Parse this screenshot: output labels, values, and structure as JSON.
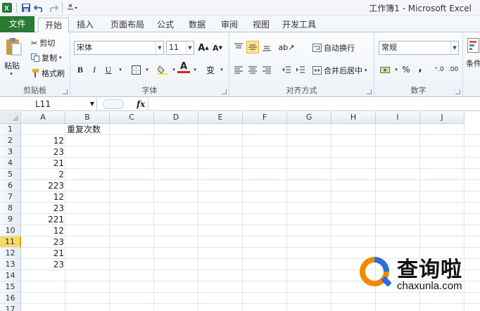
{
  "title": "工作簿1 - Microsoft Excel",
  "tabs": {
    "file": "文件",
    "items": [
      "开始",
      "插入",
      "页面布局",
      "公式",
      "数据",
      "审阅",
      "视图",
      "开发工具"
    ]
  },
  "ribbon": {
    "clipboard": {
      "paste": "粘贴",
      "cut": "剪切",
      "copy": "复制",
      "format_painter": "格式刷",
      "label": "剪贴板"
    },
    "font": {
      "name": "宋体",
      "size": "11",
      "label": "字体",
      "bold": "B",
      "italic": "I",
      "underline": "U"
    },
    "alignment": {
      "wrap": "自动换行",
      "merge": "合并后居中",
      "label": "对齐方式"
    },
    "number": {
      "format": "常规",
      "label": "数字",
      "percent": "%",
      "comma": ","
    },
    "styles": {
      "partial": "条件"
    }
  },
  "formula_bar": {
    "name_box": "L11",
    "fx": "fx",
    "content": ""
  },
  "columns": [
    "A",
    "B",
    "C",
    "D",
    "E",
    "F",
    "G",
    "H",
    "I",
    "J"
  ],
  "rows": [
    "1",
    "2",
    "3",
    "4",
    "5",
    "6",
    "7",
    "8",
    "9",
    "10",
    "11",
    "12",
    "13",
    "14",
    "15",
    "16",
    "17"
  ],
  "selected_row": "11",
  "cells": {
    "B1": "重复次数",
    "A": [
      "12",
      "23",
      "21",
      "2",
      "223",
      "12",
      "23",
      "221",
      "12",
      "23",
      "21",
      "23"
    ]
  },
  "watermark": {
    "name": "查询啦",
    "site": "chaxunla.com"
  },
  "colors": {
    "file_tab": "#2a7a34",
    "selected_header": "#f8d96b",
    "watermark_orange": "#f08a00",
    "watermark_blue": "#2a6fd6"
  }
}
